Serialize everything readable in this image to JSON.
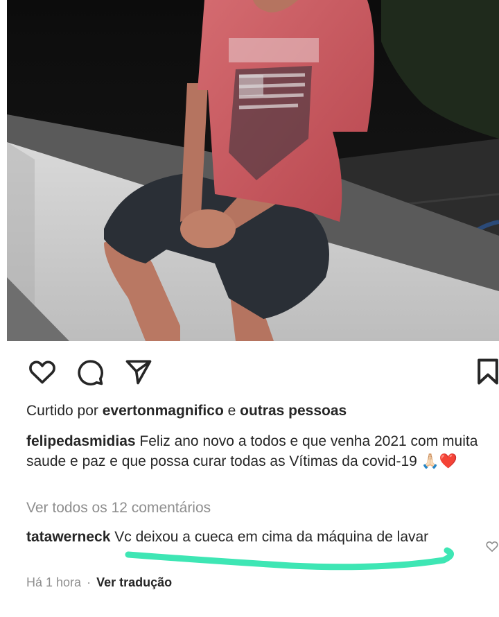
{
  "post": {
    "liked_by_prefix": "Curtido por",
    "liked_by_user": "evertonmagnifico",
    "liked_by_joiner": "e",
    "liked_by_others": "outras pessoas",
    "author": "felipedasmidias",
    "caption": "Feliz ano novo a todos e que venha 2021 com muita saude e paz e que possa curar todas as Vítimas da covid-19",
    "caption_emoji": "🙏🏻❤️",
    "view_all_comments": "Ver todos os 12 comentários"
  },
  "comment": {
    "author": "tatawerneck",
    "text": "Vc deixou a cueca em cima da máquina de lavar",
    "time": "Há 1 hora",
    "separator": "·",
    "translate_label": "Ver tradução"
  },
  "icons": {
    "like": "heart-icon",
    "comment": "comment-icon",
    "share": "send-icon",
    "save": "bookmark-icon",
    "comment_like": "heart-outline-icon"
  },
  "colors": {
    "text": "#262626",
    "muted": "#8e8e8e",
    "highlight_scribble": "#3ee6b4",
    "shirt": "#c8565e"
  }
}
